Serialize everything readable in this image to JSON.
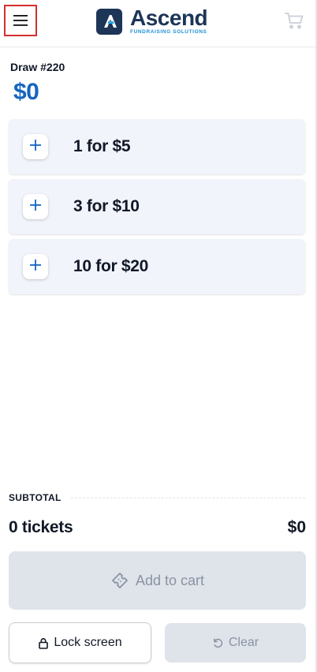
{
  "header": {
    "brand_name": "Ascend",
    "brand_tagline": "FUNDRAISING SOLUTIONS",
    "menu_icon": "hamburger-menu-icon",
    "cart_icon": "shopping-cart-icon"
  },
  "draw": {
    "label": "Draw #220",
    "amount": "$0"
  },
  "options": [
    {
      "label": "1 for $5"
    },
    {
      "label": "3 for $10"
    },
    {
      "label": "10 for $20"
    }
  ],
  "summary": {
    "subtotal_label": "SUBTOTAL",
    "ticket_count": "0 tickets",
    "subtotal_value": "$0"
  },
  "actions": {
    "add_to_cart": "Add to cart",
    "lock_screen": "Lock screen",
    "clear": "Clear"
  },
  "colors": {
    "brand_navy": "#1d3557",
    "accent_blue": "#1565c0",
    "card_bg": "#f2f4fb",
    "disabled_bg": "#dfe3ea",
    "highlight_border": "#d32f2f"
  }
}
